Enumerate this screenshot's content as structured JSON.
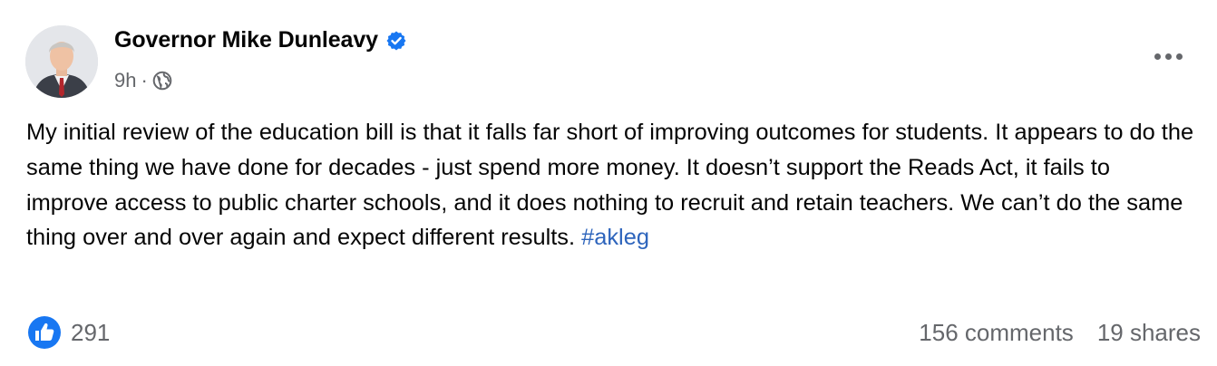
{
  "post": {
    "author": "Governor Mike Dunleavy",
    "timestamp": "9h",
    "separator": "·",
    "visibility_icon": "globe-icon",
    "verified_icon": "verified-badge-icon",
    "more_icon": "more-options-icon",
    "text": "My initial review of the education bill is that it falls far short of improving outcomes for students. It appears to do the same thing we have done for decades - just spend more money. It doesn’t support the Reads Act, it fails to improve access to public charter schools, and it does nothing to recruit and retain teachers.  We can’t do the same thing over and over again and expect different results. ",
    "hashtag": "#akleg",
    "reaction_icon": "like-icon",
    "reaction_count": "291",
    "comments": "156 comments",
    "shares": "19 shares"
  },
  "colors": {
    "verified": "#1877f2",
    "hashtag": "#2d64bc",
    "secondary_text": "#65676b",
    "like_icon_bg": "#1877f2"
  }
}
